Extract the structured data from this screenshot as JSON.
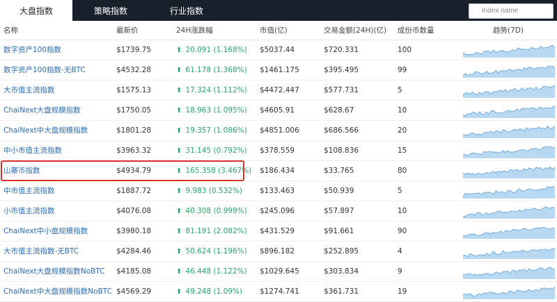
{
  "tabs": [
    {
      "label": "大盘指数",
      "active": true
    },
    {
      "label": "策略指数",
      "active": false
    },
    {
      "label": "行业指数",
      "active": false
    }
  ],
  "search": {
    "placeholder": "Index name"
  },
  "table": {
    "headers": [
      "名称",
      "最新价",
      "24H涨跌幅",
      "市值(亿)",
      "交易金额(24H)(亿)",
      "成份币数量",
      "趋势(7D)"
    ],
    "rows": [
      {
        "name": "数字资产100指数",
        "price": "$1739.75",
        "change": "20.091 (1.168%)",
        "mcap": "$5037.44",
        "volume": "$720.331",
        "count": "100"
      },
      {
        "name": "数字资产100指数-无BTC",
        "price": "$4532.28",
        "change": "61.178 (1.368%)",
        "mcap": "$1461.175",
        "volume": "$395.495",
        "count": "99"
      },
      {
        "name": "大市值主流指数",
        "price": "$1575.13",
        "change": "17.324 (1.112%)",
        "mcap": "$4472.447",
        "volume": "$577.731",
        "count": "5"
      },
      {
        "name": "ChaiNext大盘规模指数",
        "price": "$1750.05",
        "change": "18.963 (1.095%)",
        "mcap": "$4605.91",
        "volume": "$628.67",
        "count": "10"
      },
      {
        "name": "ChaiNext中大盘规模指数",
        "price": "$1801.28",
        "change": "19.357 (1.086%)",
        "mcap": "$4851.006",
        "volume": "$686.566",
        "count": "20"
      },
      {
        "name": "中小市值主流指数",
        "price": "$3963.32",
        "change": "31.145 (0.792%)",
        "mcap": "$378.559",
        "volume": "$108.836",
        "count": "15"
      },
      {
        "name": "山寨币指数",
        "price": "$4934.79",
        "change": "165.358 (3.467%)",
        "mcap": "$186.434",
        "volume": "$33.765",
        "count": "80"
      },
      {
        "name": "中市值主流指数",
        "price": "$1887.72",
        "change": "9.983 (0.532%)",
        "mcap": "$133.463",
        "volume": "$50.939",
        "count": "5"
      },
      {
        "name": "小市值主流指数",
        "price": "$4076.08",
        "change": "40.308 (0.999%)",
        "mcap": "$245.096",
        "volume": "$57.897",
        "count": "10"
      },
      {
        "name": "ChaiNext中小盘规模指数",
        "price": "$3980.18",
        "change": "81.191 (2.082%)",
        "mcap": "$431.529",
        "volume": "$91.661",
        "count": "90"
      },
      {
        "name": "大市值主流指数-无BTC",
        "price": "$4284.46",
        "change": "50.624 (1.196%)",
        "mcap": "$896.182",
        "volume": "$252.895",
        "count": "4"
      },
      {
        "name": "ChaiNext大盘规模指数NoBTC",
        "price": "$4185.08",
        "change": "46.448 (1.122%)",
        "mcap": "$1029.645",
        "volume": "$303.834",
        "count": "9"
      },
      {
        "name": "ChaiNext中大盘规模指数NoBTC",
        "price": "$4569.29",
        "change": "49.248 (1.09%)",
        "mcap": "$1274.741",
        "volume": "$361.731",
        "count": "19"
      }
    ]
  },
  "colors": {
    "header_bg": "#18202b",
    "link": "#2b6cb0",
    "up": "#27a56a",
    "highlight": "#d9342b",
    "sparkline": "#7fb8e6"
  },
  "icons": {
    "up_arrow": "up-arrow-icon"
  }
}
